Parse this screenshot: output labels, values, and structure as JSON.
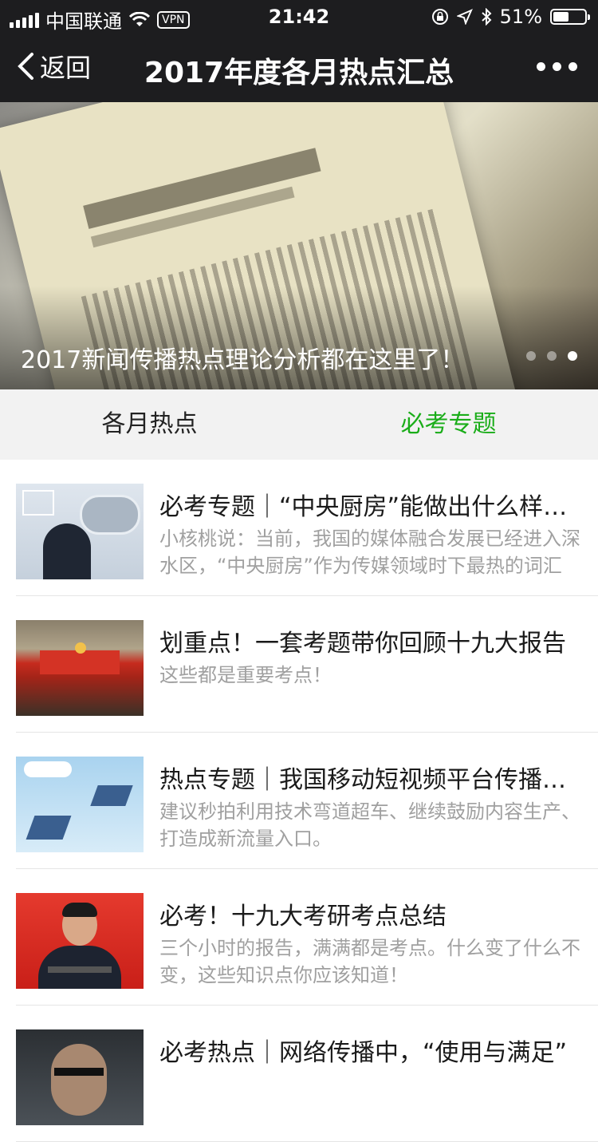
{
  "status_bar": {
    "carrier": "中国联通",
    "vpn": "VPN",
    "time": "21:42",
    "battery": "51%",
    "battery_level": 0.51
  },
  "nav": {
    "back_label": "返回",
    "title": "2017年度各月热点汇总"
  },
  "banner": {
    "caption": "2017新闻传播热点理论分析都在这里了！",
    "page_count": 3,
    "active_index": 3
  },
  "tabs": [
    {
      "label": "各月热点",
      "active": false
    },
    {
      "label": "必考专题",
      "active": true
    }
  ],
  "accent_color": "#1aad19",
  "articles": [
    {
      "title": "必考专题｜“中央厨房”能做出什么样的菜",
      "desc": "小核桃说：当前，我国的媒体融合发展已经进入深水区，“中央厨房”作为传媒领域时下最热的词汇"
    },
    {
      "title": "划重点！一套考题带你回顾十九大报告",
      "desc": "这些都是重要考点！"
    },
    {
      "title": "热点专题｜我国移动短视频平台传播分析",
      "desc": "建议秒拍利用技术弯道超车、继续鼓励内容生产、打造成新流量入口。"
    },
    {
      "title": "必考！十九大考研考点总结",
      "desc": "三个小时的报告，满满都是考点。什么变了什么不变，这些知识点你应该知道！"
    },
    {
      "title": "必考热点｜网络传播中，“使用与满足”",
      "desc": ""
    }
  ]
}
